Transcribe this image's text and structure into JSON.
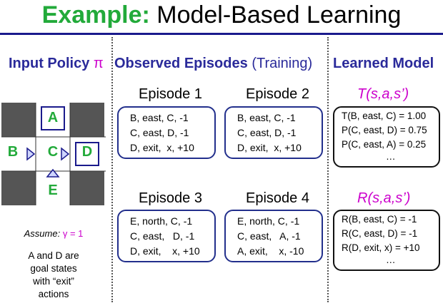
{
  "title": {
    "keyword": "Example:",
    "rest": " Model-Based Learning"
  },
  "columns": {
    "input_policy": "Input Policy",
    "pi": "π",
    "observed": "Observed Episodes",
    "training": "(Training)",
    "learned": "Learned Model"
  },
  "grid": {
    "labels": {
      "A": "A",
      "B": "B",
      "C": "C",
      "D": "D",
      "E": "E"
    }
  },
  "assumption": {
    "label": "Assume:",
    "gamma": "γ = 1"
  },
  "goal_note": [
    "A and D are",
    "goal states",
    "with “exit”",
    "actions"
  ],
  "episodes": [
    {
      "title": "Episode 1",
      "lines": [
        "B, east, C, -1",
        "C, east, D, -1",
        "D, exit,  x, +10"
      ]
    },
    {
      "title": "Episode 2",
      "lines": [
        "B, east, C, -1",
        "C, east, D, -1",
        "D, exit,  x, +10"
      ]
    },
    {
      "title": "Episode 3",
      "lines": [
        "E, north, C, -1",
        "C, east,   D, -1",
        "D, exit,    x, +10"
      ]
    },
    {
      "title": "Episode 4",
      "lines": [
        "E, north, C, -1",
        "C, east,   A, -1",
        "A, exit,    x, -10"
      ]
    }
  ],
  "model": {
    "t_title": "T(s,a,s’)",
    "t_lines": [
      "T(B, east, C) = 1.00",
      "P(C, east, D) = 0.75",
      "P(C, east, A) = 0.25",
      "…"
    ],
    "r_title": "R(s,a,s’)",
    "r_lines": [
      "R(B, east, C) = -1",
      "R(C, east, D) = -1",
      "R(D, exit, x) = +10",
      "…"
    ]
  },
  "colors": {
    "accent_green": "#22aa3a",
    "heading_blue": "#2a2a9a",
    "magenta": "#cc00cc",
    "rule": "#1a1a8c"
  }
}
